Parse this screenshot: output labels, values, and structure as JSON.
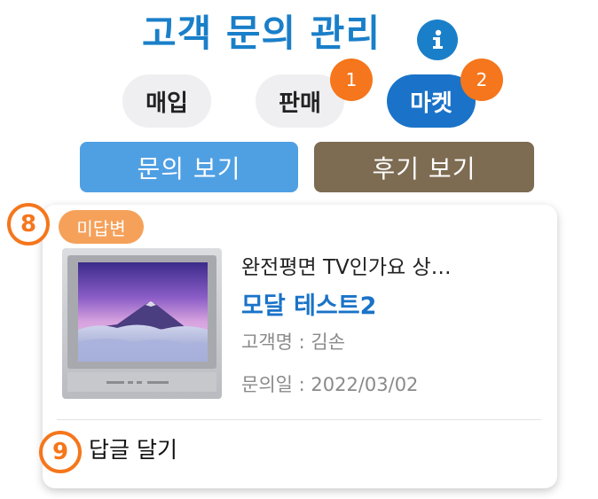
{
  "header": {
    "title": "고객 문의 관리",
    "info_icon": "info-icon"
  },
  "tabs": [
    {
      "label": "매입",
      "active": false,
      "badge": ""
    },
    {
      "label": "판매",
      "active": false,
      "badge": "1"
    },
    {
      "label": "마켓",
      "active": true,
      "badge": "2"
    }
  ],
  "view_buttons": {
    "inquiry_label": "문의 보기",
    "inquiry_color": "#4f9fe3",
    "review_label": "후기 보기",
    "review_color": "#7d6b52"
  },
  "card": {
    "step_marker_top": "8",
    "status": "미답변",
    "product_name": "완전평면 TV인가요 상…",
    "inquiry_title": "모달 테스트2",
    "customer": "고객명 : 김손",
    "date": "문의일 : 2022/03/02",
    "step_marker_bottom": "9",
    "reply_label": "답글 달기"
  },
  "colors": {
    "accent": "#1a7fc9",
    "badge": "#f5761c"
  }
}
